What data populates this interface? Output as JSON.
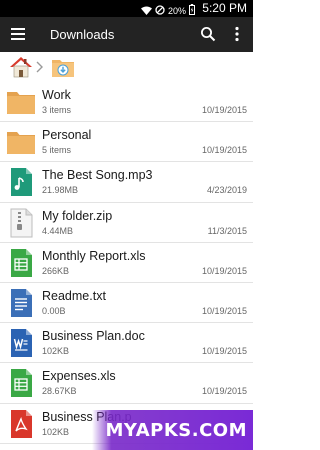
{
  "status_bar": {
    "battery": "20%",
    "time": "5:20 PM"
  },
  "app_bar": {
    "title": "Downloads",
    "icons": [
      "menu-icon",
      "search-icon",
      "more-vert-icon"
    ]
  },
  "breadcrumb": {
    "items": [
      "home-icon",
      "downloads-folder-icon"
    ]
  },
  "files": [
    {
      "name": "Work",
      "detail": "3 items",
      "date": "10/19/2015",
      "type": "folder"
    },
    {
      "name": "Personal",
      "detail": "5 items",
      "date": "10/19/2015",
      "type": "folder"
    },
    {
      "name": "The Best Song.mp3",
      "detail": "21.98MB",
      "date": "4/23/2019",
      "type": "audio"
    },
    {
      "name": "My folder.zip",
      "detail": "4.44MB",
      "date": "11/3/2015",
      "type": "zip"
    },
    {
      "name": "Monthly Report.xls",
      "detail": "266KB",
      "date": "10/19/2015",
      "type": "sheet"
    },
    {
      "name": "Readme.txt",
      "detail": "0.00B",
      "date": "10/19/2015",
      "type": "text"
    },
    {
      "name": "Business Plan.doc",
      "detail": "102KB",
      "date": "10/19/2015",
      "type": "word"
    },
    {
      "name": "Expenses.xls",
      "detail": "28.67KB",
      "date": "10/19/2015",
      "type": "sheet"
    },
    {
      "name": "Business Plan.p",
      "detail": "102KB",
      "date": "10/19/2015",
      "type": "pdf"
    }
  ],
  "watermark": "MYAPKS.COM",
  "colors": {
    "app_bar": "#232323",
    "folder": "#f0b565",
    "audio": "#1f9a7a",
    "sheet": "#3aa845",
    "word": "#2b63b3",
    "pdf": "#d9372b",
    "text": "#3b6fb7"
  }
}
